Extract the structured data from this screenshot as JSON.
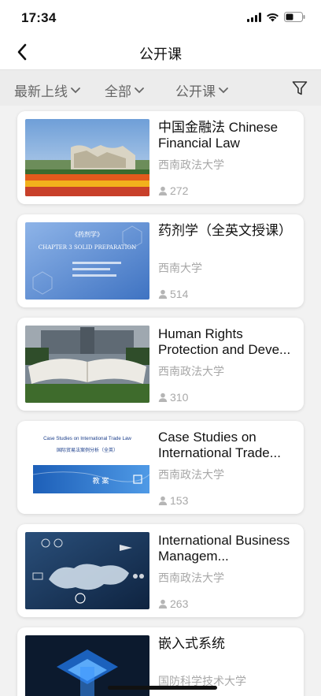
{
  "status": {
    "time": "17:34"
  },
  "nav": {
    "title": "公开课"
  },
  "filters": [
    {
      "label": "最新上线"
    },
    {
      "label": "全部"
    },
    {
      "label": "公开课"
    }
  ],
  "courses": [
    {
      "title": "中国金融法 Chinese Financial Law",
      "school": "西南政法大学",
      "views": "272",
      "thumb": "campus-garden-photo"
    },
    {
      "title": "药剂学（全英文授课）",
      "school": "西南大学",
      "views": "514",
      "thumb": "pharmaceutics-cover"
    },
    {
      "title": "Human Rights Protection and Deve...",
      "school": "西南政法大学",
      "views": "310",
      "thumb": "book-sculpture-photo"
    },
    {
      "title": "Case Studies on International Trade...",
      "school": "西南政法大学",
      "views": "153",
      "thumb": "trade-law-cover"
    },
    {
      "title": "International Business Managem...",
      "school": "西南政法大学",
      "views": "263",
      "thumb": "business-world-map"
    },
    {
      "title": "嵌入式系统",
      "school": "国防科学技术大学",
      "views": "",
      "thumb": "circuit-chip-image"
    }
  ],
  "thumb_texts": {
    "pharma_title": "《药剂学》",
    "pharma_chapter": "CHAPTER 3 SOLID PREPARATION",
    "trade_en": "Case Studies on International Trade Law",
    "trade_cn": "国际贸易法案例分析（全英）",
    "trade_badge": "教 案"
  },
  "colors": {
    "accent": "#111111",
    "muted": "#a8a8a8",
    "filter_text": "#666666"
  }
}
